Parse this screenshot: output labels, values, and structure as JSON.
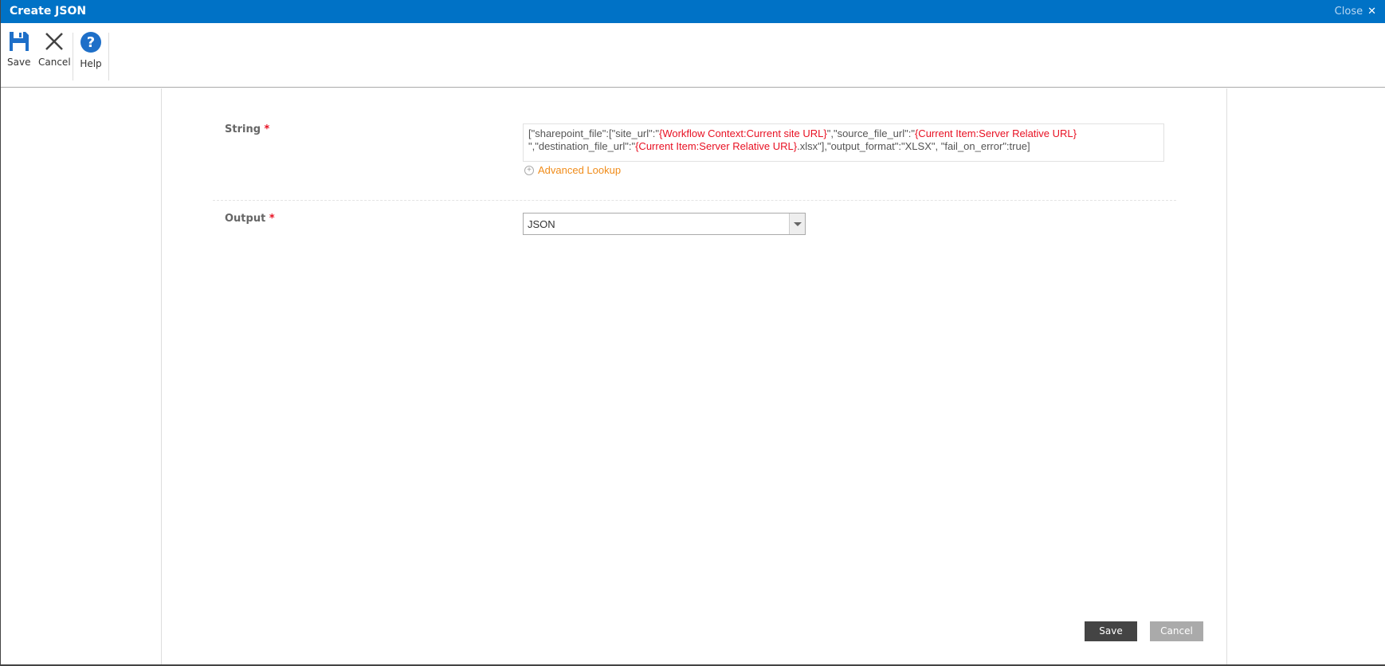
{
  "window": {
    "title": "Create JSON",
    "close_label": "Close"
  },
  "toolbar": {
    "save": "Save",
    "cancel": "Cancel",
    "help": "Help"
  },
  "form": {
    "string_label": "String",
    "output_label": "Output",
    "required_mark": "*",
    "string_value": [
      {
        "t": "[\"sharepoint_file\":[\"site_url\":\"",
        "tok": false
      },
      {
        "t": "{Workflow Context:Current site URL}",
        "tok": true
      },
      {
        "t": "\",\"source_file_url\":\"",
        "tok": false
      },
      {
        "t": "{Current Item:Server Relative URL}",
        "tok": true
      },
      {
        "t": " \",\"destination_file_url\":\"",
        "tok": false
      },
      {
        "t": "{Current Item:Server Relative URL}",
        "tok": true
      },
      {
        "t": ".xlsx\"],\"output_format\":\"XLSX\", \"fail_on_error\":true]",
        "tok": false
      }
    ],
    "advanced_lookup": "Advanced Lookup",
    "output_value": "JSON"
  },
  "footer": {
    "save": "Save",
    "cancel": "Cancel"
  },
  "colors": {
    "accent": "#0072c6",
    "token": "#e81123",
    "link": "#f08c1a"
  }
}
